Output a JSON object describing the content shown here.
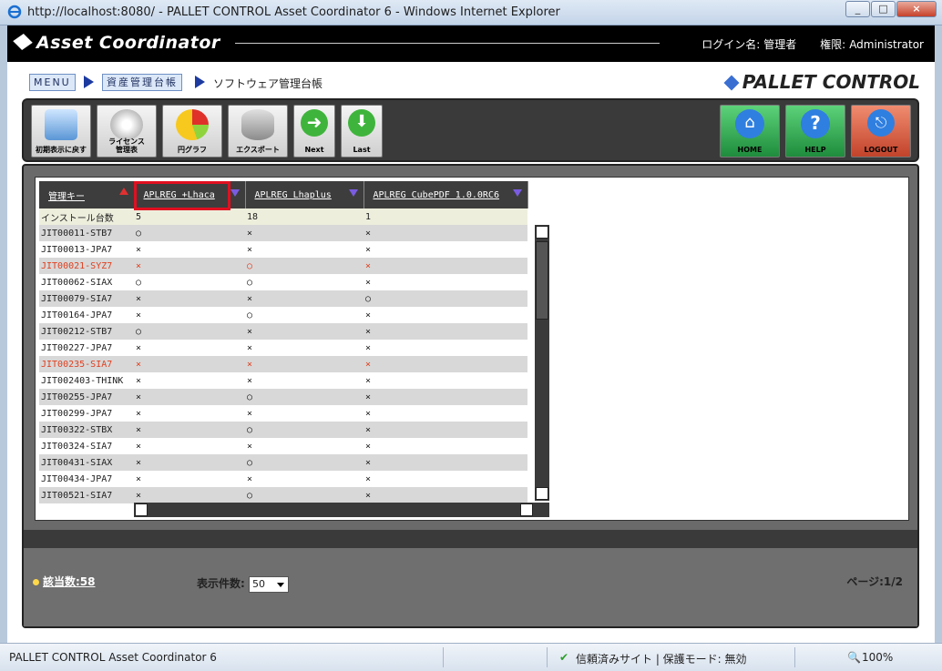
{
  "window": {
    "title": "http://localhost:8080/ - PALLET CONTROL Asset Coordinator 6 - Windows Internet Explorer"
  },
  "header": {
    "logo": "Asset Coordinator",
    "login_label": "ログイン名:",
    "login_name": "管理者",
    "role_label": "権限:",
    "role_value": "Administrator"
  },
  "breadcrumb": {
    "menu": "MENU",
    "asset": "資産管理台帳",
    "current": "ソフトウェア管理台帳",
    "brand": "PALLET CONTROL"
  },
  "toolbar": {
    "reset": "初期表示に戻す",
    "license": "ライセンス\n管理表",
    "pie": "円グラフ",
    "export": "エクスポート",
    "next": "Next",
    "last": "Last",
    "home": "HOME",
    "help": "HELP",
    "logout": "LOGOUT"
  },
  "grid": {
    "headers": [
      "管理キー",
      "APLREG +Lhaca",
      "APLREG Lhaplus",
      "APLREG CubePDF 1.0.0RC6"
    ],
    "count_row": [
      "インストール台数",
      "5",
      "18",
      "1"
    ],
    "rows": [
      {
        "key": "JIT00011-STB7",
        "c1": "○",
        "c2": "×",
        "c3": "×",
        "red": false
      },
      {
        "key": "JIT00013-JPA7",
        "c1": "×",
        "c2": "×",
        "c3": "×",
        "red": false
      },
      {
        "key": "JIT00021-SYZ7",
        "c1": "×",
        "c2": "○",
        "c3": "×",
        "red": true
      },
      {
        "key": "JIT00062-SIAX",
        "c1": "○",
        "c2": "○",
        "c3": "×",
        "red": false
      },
      {
        "key": "JIT00079-SIA7",
        "c1": "×",
        "c2": "×",
        "c3": "○",
        "red": false
      },
      {
        "key": "JIT00164-JPA7",
        "c1": "×",
        "c2": "○",
        "c3": "×",
        "red": false
      },
      {
        "key": "JIT00212-STB7",
        "c1": "○",
        "c2": "×",
        "c3": "×",
        "red": false
      },
      {
        "key": "JIT00227-JPA7",
        "c1": "×",
        "c2": "×",
        "c3": "×",
        "red": false
      },
      {
        "key": "JIT00235-SIA7",
        "c1": "×",
        "c2": "×",
        "c3": "×",
        "red": true
      },
      {
        "key": "JIT002403-THINK",
        "c1": "×",
        "c2": "×",
        "c3": "×",
        "red": false
      },
      {
        "key": "JIT00255-JPA7",
        "c1": "×",
        "c2": "○",
        "c3": "×",
        "red": false
      },
      {
        "key": "JIT00299-JPA7",
        "c1": "×",
        "c2": "×",
        "c3": "×",
        "red": false
      },
      {
        "key": "JIT00322-STBX",
        "c1": "×",
        "c2": "○",
        "c3": "×",
        "red": false
      },
      {
        "key": "JIT00324-SIA7",
        "c1": "×",
        "c2": "×",
        "c3": "×",
        "red": false
      },
      {
        "key": "JIT00431-SIAX",
        "c1": "×",
        "c2": "○",
        "c3": "×",
        "red": false
      },
      {
        "key": "JIT00434-JPA7",
        "c1": "×",
        "c2": "×",
        "c3": "×",
        "red": false
      },
      {
        "key": "JIT00521-SIA7",
        "c1": "×",
        "c2": "○",
        "c3": "×",
        "red": false
      }
    ]
  },
  "footer": {
    "hits": "該当数:58",
    "perpage_label": "表示件数:",
    "perpage_value": "50",
    "page": "ページ:1/2"
  },
  "status": {
    "left": "PALLET CONTROL Asset Coordinator 6",
    "trusted": "信頼済みサイト | 保護モード: 無効",
    "zoom": "100%"
  }
}
